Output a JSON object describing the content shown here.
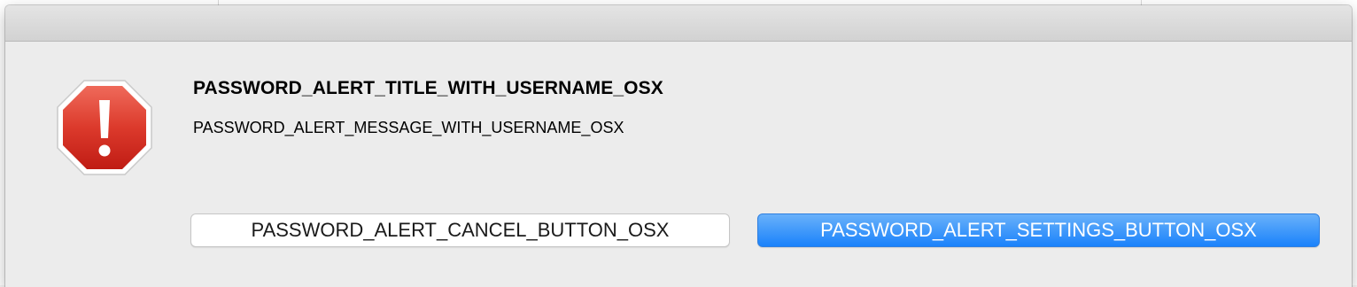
{
  "alert": {
    "title": "PASSWORD_ALERT_TITLE_WITH_USERNAME_OSX",
    "message": "PASSWORD_ALERT_MESSAGE_WITH_USERNAME_OSX",
    "icon": "warning-octagon-icon",
    "icon_glyph": "!",
    "icon_color": "#d32a1f"
  },
  "buttons": {
    "cancel_label": "PASSWORD_ALERT_CANCEL_BUTTON_OSX",
    "settings_label": "PASSWORD_ALERT_SETTINGS_BUTTON_OSX",
    "accent_color": "#1a82fb"
  }
}
